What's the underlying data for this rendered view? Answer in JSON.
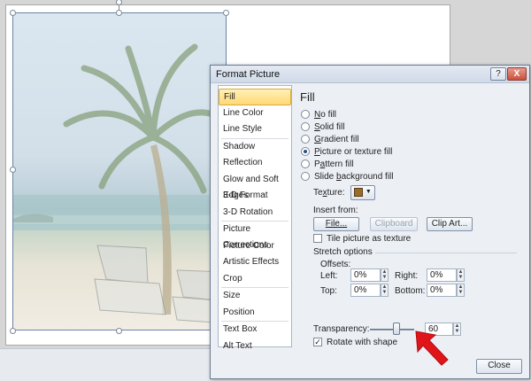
{
  "dialog": {
    "title": "Format Picture",
    "help_btn": "?",
    "close_btn": "X",
    "footer_close": "Close"
  },
  "nav": {
    "items": [
      {
        "label": "Fill",
        "active": true
      },
      {
        "label": "Line Color"
      },
      {
        "label": "Line Style"
      },
      {
        "label": "Shadow"
      },
      {
        "label": "Reflection"
      },
      {
        "label": "Glow and Soft Edges"
      },
      {
        "label": "3-D Format"
      },
      {
        "label": "3-D Rotation"
      },
      {
        "label": "Picture Corrections"
      },
      {
        "label": "Picture Color"
      },
      {
        "label": "Artistic Effects"
      },
      {
        "label": "Crop"
      },
      {
        "label": "Size"
      },
      {
        "label": "Position"
      },
      {
        "label": "Text Box"
      },
      {
        "label": "Alt Text"
      }
    ]
  },
  "fill": {
    "heading": "Fill",
    "options": [
      {
        "pre": "",
        "key": "N",
        "post": "o fill",
        "selected": false
      },
      {
        "pre": "",
        "key": "S",
        "post": "olid fill",
        "selected": false
      },
      {
        "pre": "",
        "key": "G",
        "post": "radient fill",
        "selected": false
      },
      {
        "pre": "",
        "key": "P",
        "post": "icture or texture fill",
        "selected": true
      },
      {
        "pre": "P",
        "key": "a",
        "post": "ttern fill",
        "selected": false
      },
      {
        "pre": "Slide ",
        "key": "b",
        "post": "ackground fill",
        "selected": false
      }
    ],
    "texture_pre": "Te",
    "texture_key": "x",
    "texture_post": "ture:",
    "insert_from": "Insert from:",
    "file_btn": "File...",
    "clipboard_btn": "Clipboard",
    "clipart_btn": "Clip Art...",
    "tile_label": "Tile picture as texture",
    "tile_checked": false,
    "stretch_label": "Stretch options",
    "offsets_label": "Offsets:",
    "left_label": "Left:",
    "left_value": "0%",
    "right_label": "Right:",
    "right_value": "0%",
    "top_label": "Top:",
    "top_value": "0%",
    "bottom_label": "Bottom:",
    "bottom_value": "0%",
    "transparency_label": "Transparency:",
    "transparency_value": "60",
    "transparency_level": 0.6,
    "rotate_label": "Rotate with shape",
    "rotate_checked": true
  },
  "colors": {
    "annotation_arrow": "#e0151a",
    "nav_active": "#ffd873"
  }
}
